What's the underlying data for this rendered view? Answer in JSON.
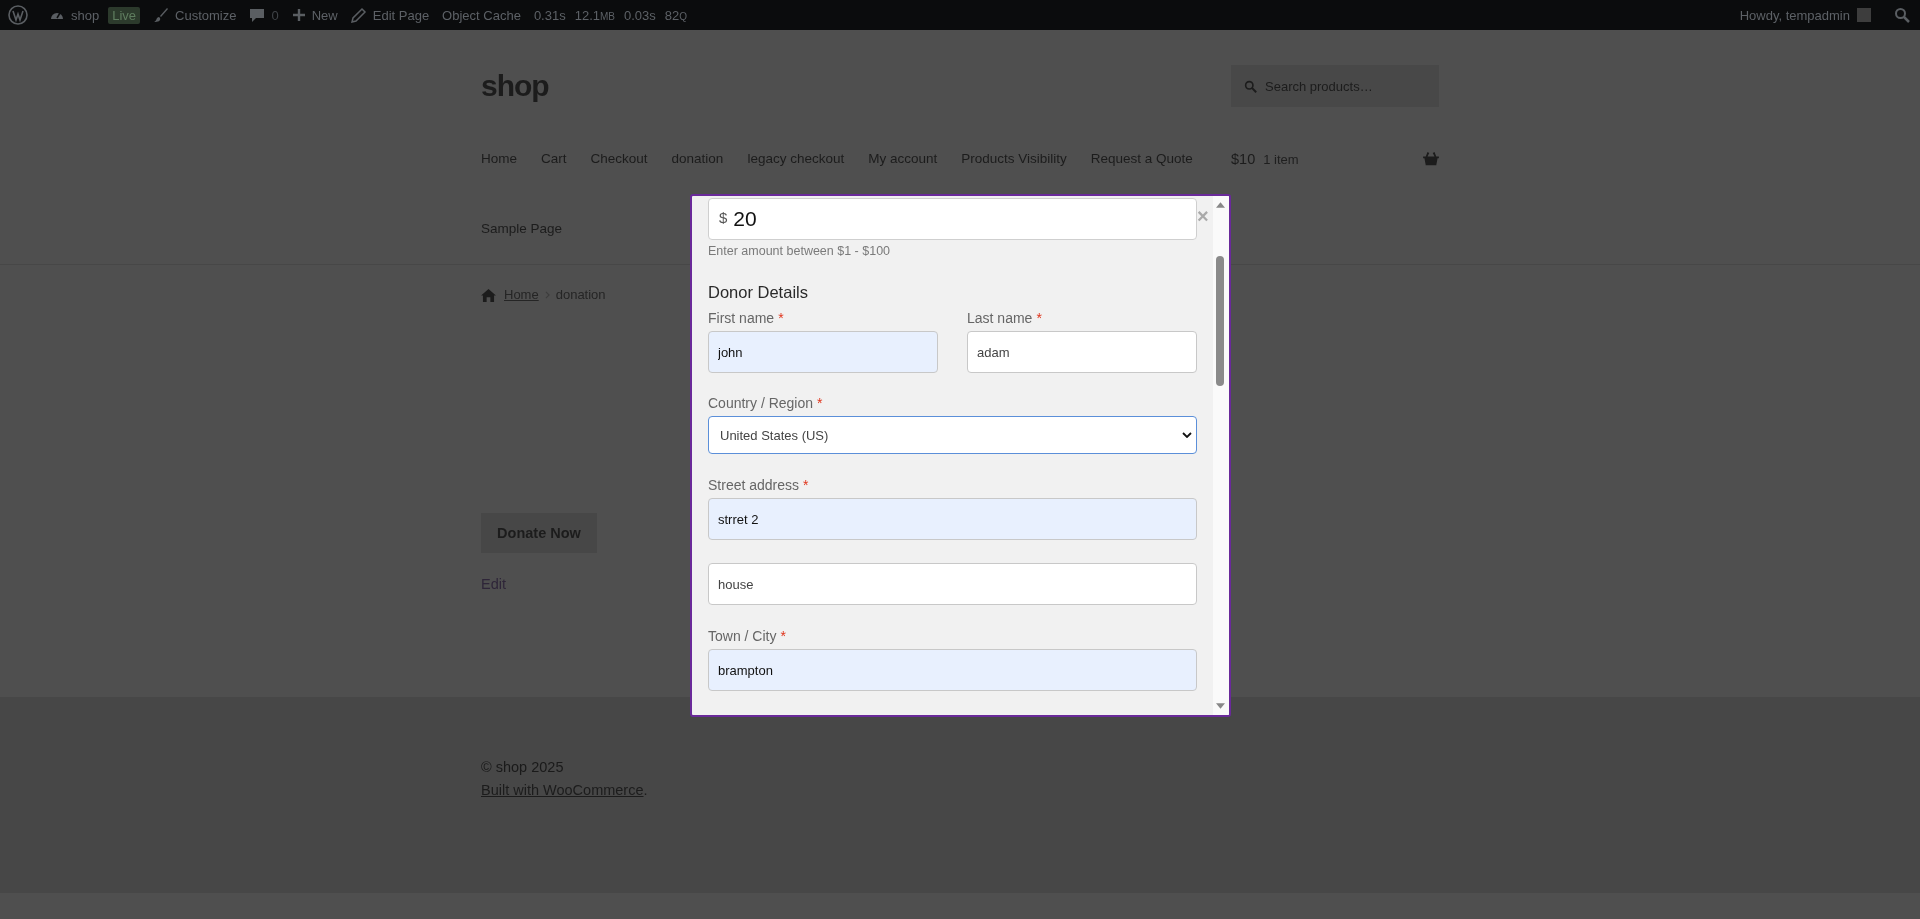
{
  "admin_bar": {
    "items": [
      {
        "kind": "site",
        "label": "shop"
      },
      {
        "kind": "badge",
        "label": "Live"
      },
      {
        "kind": "customize",
        "label": "Customize"
      },
      {
        "kind": "comments",
        "label": "0"
      },
      {
        "kind": "new",
        "label": "New"
      },
      {
        "kind": "edit",
        "label": "Edit Page"
      },
      {
        "kind": "plain",
        "label": "Object Cache"
      },
      {
        "kind": "stat",
        "label": "0.31s"
      },
      {
        "kind": "stat",
        "label": "12.1",
        "unit": "MB"
      },
      {
        "kind": "stat",
        "label": "0.03s"
      },
      {
        "kind": "stat",
        "label": "82",
        "unit": "Q"
      }
    ],
    "greeting": "Howdy, tempadmin"
  },
  "header": {
    "site_title": "shop",
    "search": {
      "placeholder": "Search products…"
    },
    "nav": [
      "Home",
      "Cart",
      "Checkout",
      "donation",
      "legacy checkout",
      "My account",
      "Products Visibility",
      "Request a Quote",
      "Sample Page"
    ],
    "cart": {
      "total": "$10",
      "count": "1 item"
    }
  },
  "breadcrumb": {
    "home": "Home",
    "current": "donation"
  },
  "donate_button": "Donate Now",
  "edit_link": "Edit",
  "footer": {
    "copyright": "© shop 2025",
    "credit_link": "Built with WooCommerce",
    "credit_after": "."
  },
  "modal": {
    "amount": {
      "currency": "$",
      "value": "20",
      "hint": "Enter amount between $1 - $100"
    },
    "close": "×",
    "section_title": "Donor Details",
    "name_fields": [
      {
        "label": "First name",
        "required_mark": "*",
        "value": "john",
        "autofilled": true
      },
      {
        "label": "Last name",
        "required_mark": "*",
        "value": "adam",
        "autofilled": false
      }
    ],
    "country": {
      "label": "Country / Region",
      "required_mark": "*",
      "value": "United States (US)",
      "focused": true
    },
    "street": {
      "label": "Street address",
      "required_mark": "*",
      "value": "strret 2",
      "autofilled": true
    },
    "street2": {
      "value": "house",
      "autofilled": false
    },
    "city": {
      "label": "Town / City",
      "required_mark": "*",
      "value": "brampton",
      "autofilled": true
    }
  }
}
